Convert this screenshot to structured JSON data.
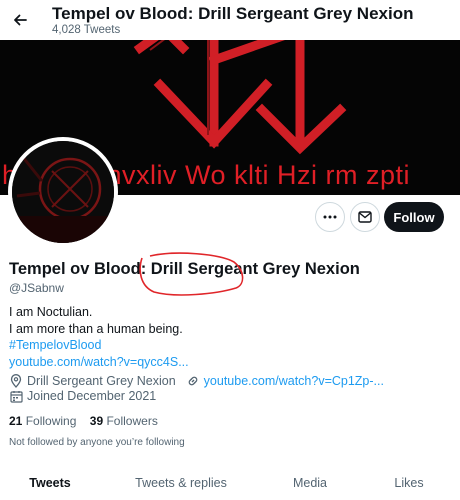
{
  "header": {
    "title": "Tempel ov Blood: Drill Sergeant Grey Nexion",
    "subtitle": "4,028 Tweets"
  },
  "banner": {
    "text": "Ihvxlm b hvxliv Wo klti Hzi rm zpti"
  },
  "actions": {
    "follow_label": "Follow"
  },
  "profile": {
    "display_name": "Tempel ov Blood: Drill Sergeant Grey Nexion",
    "handle": "@JSabnw",
    "bio_lines": [
      "I am Noctulian.",
      "I am more than a human being.",
      "#TempelovBlood",
      "youtube.com/watch?v=qycc4S..."
    ],
    "location": "Drill Sergeant Grey Nexion",
    "website": "youtube.com/watch?v=Cp1Zp-...",
    "joined": "Joined December 2021",
    "following_count": "21",
    "following_label": "Following",
    "followers_count": "39",
    "followers_label": "Followers",
    "not_followed_text": "Not followed by anyone you’re following"
  },
  "tabs": [
    {
      "label": "Tweets",
      "active": true
    },
    {
      "label": "Tweets & replies",
      "active": false
    },
    {
      "label": "Media",
      "active": false
    },
    {
      "label": "Likes",
      "active": false
    }
  ],
  "colors": {
    "accent_link": "#1d9bf0",
    "banner_red": "#e01f26",
    "annotation_red": "#e0262a"
  },
  "icons": [
    "back-arrow-icon",
    "more-icon",
    "message-icon",
    "location-icon",
    "link-icon",
    "calendar-icon"
  ]
}
